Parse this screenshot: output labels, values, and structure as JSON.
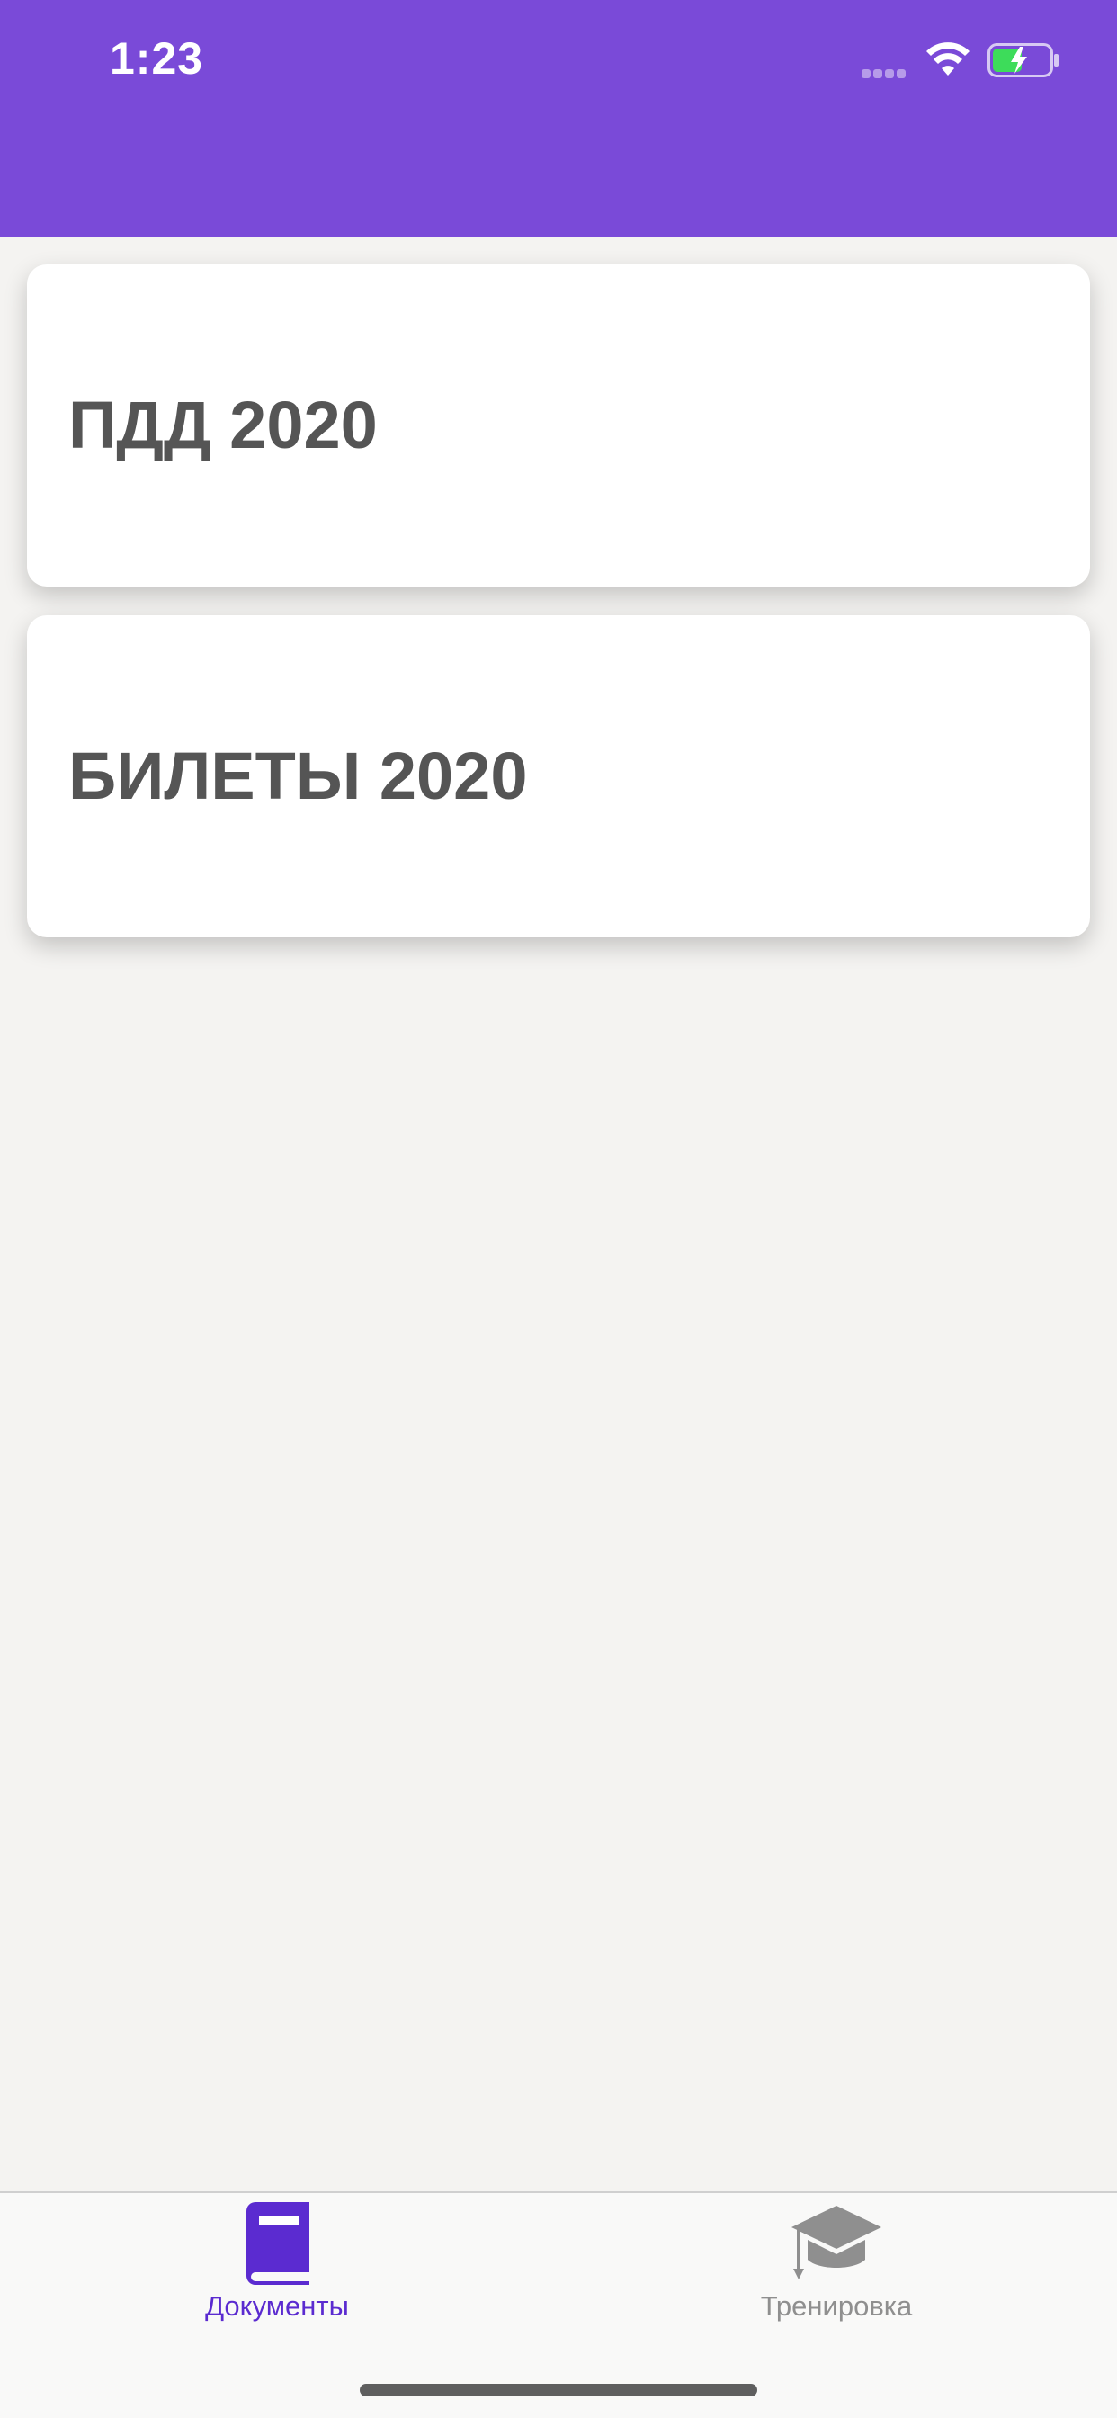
{
  "status_bar": {
    "time": "1:23"
  },
  "colors": {
    "header": "#7a4ad8",
    "active_tab": "#5b2bd0",
    "inactive_tab": "#8f8f8f",
    "card_text": "#555555",
    "background": "#f4f3f1"
  },
  "cards": [
    {
      "title": "ПДД 2020"
    },
    {
      "title": "БИЛЕТЫ 2020"
    }
  ],
  "tabs": [
    {
      "label": "Документы",
      "icon": "book-icon",
      "active": true
    },
    {
      "label": "Тренировка",
      "icon": "graduation-cap-icon",
      "active": false
    }
  ]
}
